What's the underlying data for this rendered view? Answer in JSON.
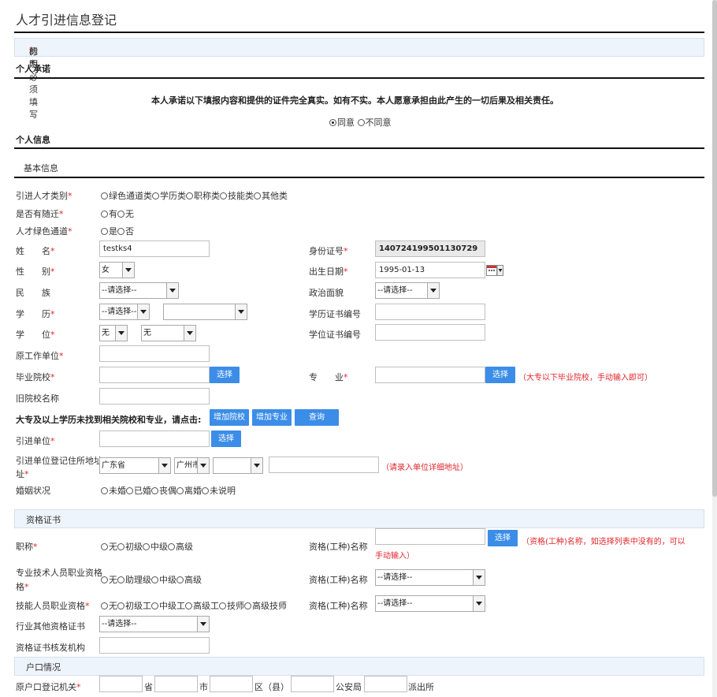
{
  "page_title": "人才引进信息登记",
  "notice": {
    "prefix": "标明",
    "star": "*",
    "suffix": "的为必须填写"
  },
  "sections": {
    "promise": "个人承诺",
    "personal": "个人信息",
    "basic": "基本信息",
    "qualification": "资格证书",
    "household": "户口情况"
  },
  "promise": {
    "text": "本人承诺以下填报内容和提供的证件完全真实。如有不实。本人愿意承担由此产生的一切后果及相关责任。",
    "agree": "同意",
    "disagree": "不同意",
    "selected": "agree"
  },
  "labels": {
    "talent_type": "引进人才类别",
    "with_family": "是否有随迁",
    "green_channel": "人才绿色通道",
    "name": "姓　　名",
    "gender": "性　　别",
    "ethnicity": "民　　族",
    "education": "学　　历",
    "degree": "学　　位",
    "former_employer": "原工作单位",
    "graduate_school": "毕业院校",
    "former_school_name": "旧院校名称",
    "id_number": "身份证号",
    "birth_date": "出生日期",
    "political": "政治面貌",
    "edu_cert_no": "学历证书编号",
    "degree_cert_no": "学位证书编号",
    "major": "专　　业",
    "not_found": "大专及以上学历未找到相关院校和专业，请点击:",
    "employer": "引进单位",
    "employer_address": "引进单位登记住所地址",
    "employer_address_tail": "址",
    "marital": "婚姻状况",
    "title": "职称",
    "pro_tech": "专业技术人员职业资格",
    "pro_tech_tail": "格",
    "skill": "技能人员职业资格",
    "industry_cert": "行业其他资格证书",
    "cert_issuer": "资格证书核发机构",
    "cert_name": "资格(工种)名称",
    "household_reg": "原户口登记机关"
  },
  "options": {
    "talent_type": [
      "绿色通道类",
      "学历类",
      "职称类",
      "技能类",
      "其他类"
    ],
    "with_family": [
      "有",
      "无"
    ],
    "green_channel": [
      "是",
      "否"
    ],
    "marital": [
      "未婚",
      "已婚",
      "丧偶",
      "离婚",
      "未说明"
    ],
    "title": [
      "无",
      "初级",
      "中级",
      "高级"
    ],
    "pro_tech": [
      "无",
      "助理级",
      "中级",
      "高级"
    ],
    "skill": [
      "无",
      "初级工",
      "中级工",
      "高级工",
      "技师",
      "高级技师"
    ]
  },
  "values": {
    "name": "testks4",
    "id_number": "140724199501130729",
    "gender": "女",
    "birth_date": "1995-01-13",
    "ethnicity": "--请选择--",
    "political": "--请选择--",
    "education": "--请选择--",
    "education_detail": "",
    "degree": "无",
    "degree_detail": "无",
    "province": "广东省",
    "city": "广州市",
    "district": "",
    "industry_cert": "--请选择--",
    "pro_tech_cert_name": "--请选择--",
    "skill_cert_name": "--请选择--"
  },
  "buttons": {
    "select": "选择",
    "add_school": "增加院校",
    "add_major": "增加专业",
    "query": "查询"
  },
  "hints": {
    "major": "（大专以下毕业院校，手动输入即可）",
    "address": "（请录入单位详细地址）",
    "cert_name_1": "（资格(工种)名称，如选择列表中没有的，可以",
    "cert_name_2": "手动输入）"
  },
  "household": {
    "province": "省",
    "city": "市",
    "district": "区（县）",
    "police": "公安局",
    "station": "派出所"
  }
}
